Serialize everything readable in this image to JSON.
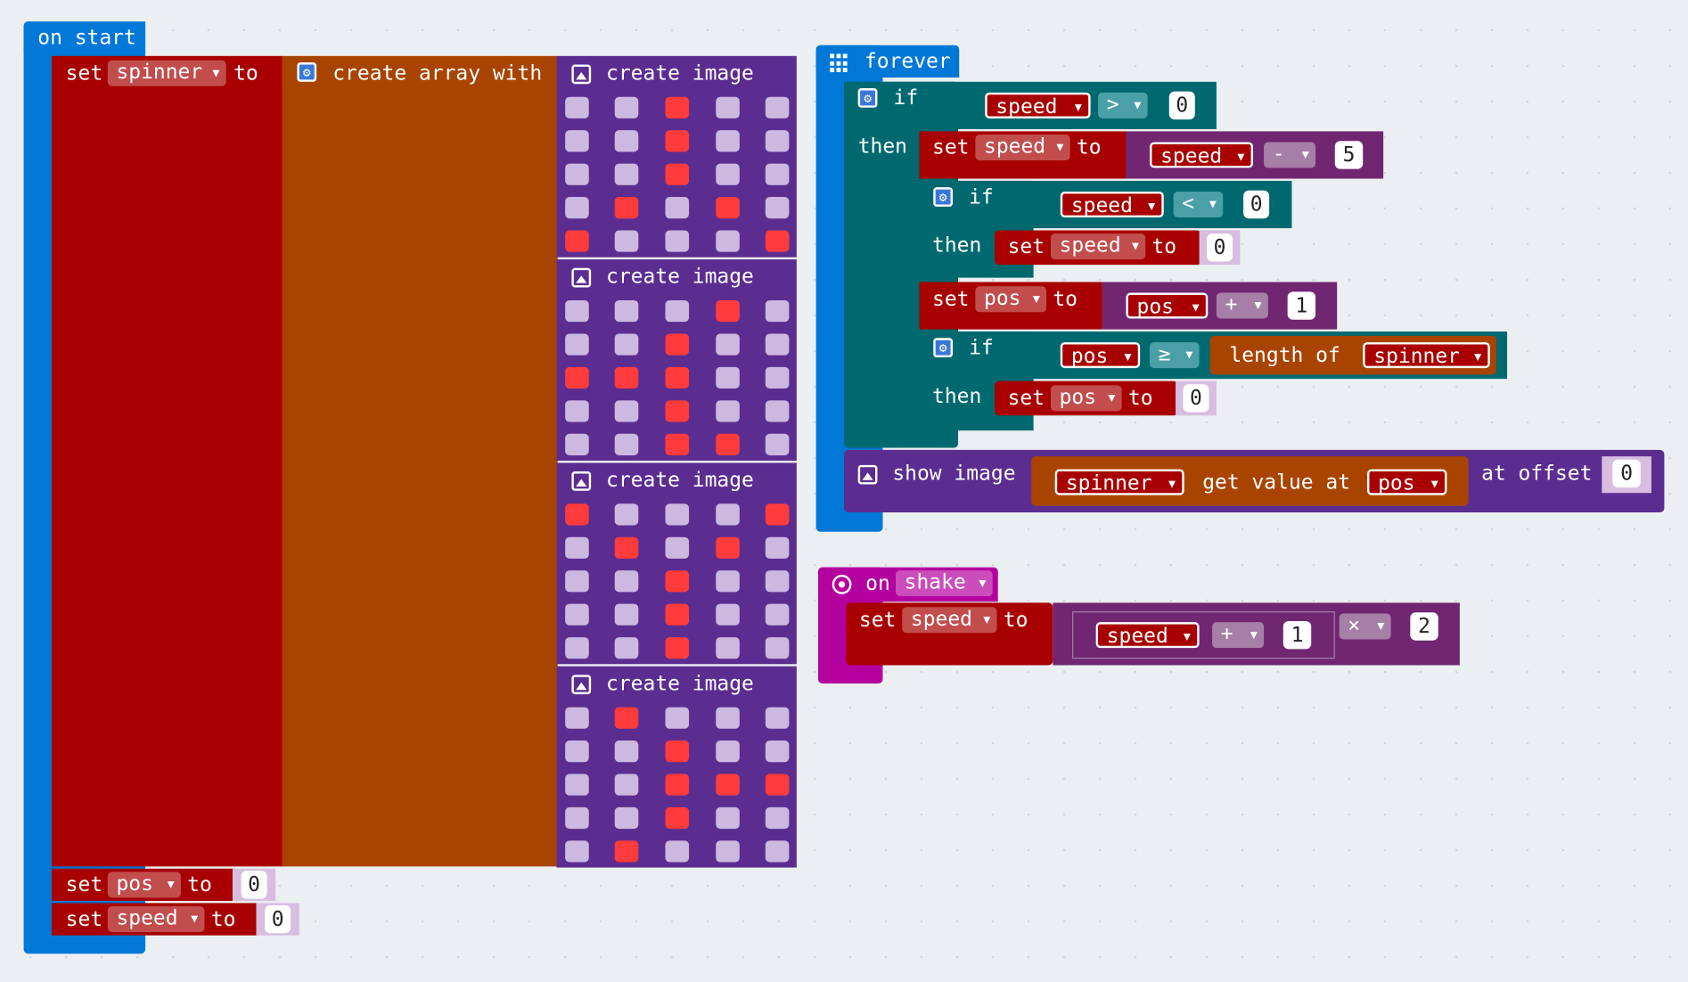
{
  "colors": {
    "event_blue": "#0078d7",
    "variables_red": "#a80000",
    "arrays_orange": "#a94400",
    "images_purple": "#5c2d91",
    "logic_teal": "#006970",
    "math_purple": "#712672",
    "input_magenta": "#b4009e",
    "led_on": "#ff3b3b",
    "led_off": "#cdb8e0"
  },
  "on_start": {
    "label": "on start",
    "set_spinner": {
      "set": "set",
      "var": "spinner",
      "to": "to"
    },
    "create_array_label": "create array with",
    "create_image_label": "create image",
    "images": [
      [
        [
          0,
          0,
          1,
          0,
          0
        ],
        [
          0,
          0,
          1,
          0,
          0
        ],
        [
          0,
          0,
          1,
          0,
          0
        ],
        [
          0,
          1,
          0,
          1,
          0
        ],
        [
          1,
          0,
          0,
          0,
          1
        ]
      ],
      [
        [
          0,
          0,
          0,
          1,
          0
        ],
        [
          0,
          0,
          1,
          0,
          0
        ],
        [
          1,
          1,
          1,
          0,
          0
        ],
        [
          0,
          0,
          1,
          0,
          0
        ],
        [
          0,
          0,
          1,
          1,
          0
        ]
      ],
      [
        [
          1,
          0,
          0,
          0,
          1
        ],
        [
          0,
          1,
          0,
          1,
          0
        ],
        [
          0,
          0,
          1,
          0,
          0
        ],
        [
          0,
          0,
          1,
          0,
          0
        ],
        [
          0,
          0,
          1,
          0,
          0
        ]
      ],
      [
        [
          0,
          1,
          0,
          0,
          0
        ],
        [
          0,
          0,
          1,
          0,
          0
        ],
        [
          0,
          0,
          1,
          1,
          1
        ],
        [
          0,
          0,
          1,
          0,
          0
        ],
        [
          0,
          1,
          0,
          0,
          0
        ]
      ]
    ],
    "set_pos": {
      "set": "set",
      "var": "pos",
      "to": "to",
      "value": "0"
    },
    "set_speed": {
      "set": "set",
      "var": "speed",
      "to": "to",
      "value": "0"
    }
  },
  "forever": {
    "label": "forever",
    "if1": {
      "if": "if",
      "then": "then",
      "var": "speed",
      "op": ">",
      "value": "0"
    },
    "set_speed_sub": {
      "set": "set",
      "var": "speed",
      "to": "to",
      "operand": "speed",
      "op": "-",
      "value": "5"
    },
    "if2": {
      "if": "if",
      "then": "then",
      "var": "speed",
      "op": "<",
      "value": "0"
    },
    "set_speed_zero": {
      "set": "set",
      "var": "speed",
      "to": "to",
      "value": "0"
    },
    "set_pos_inc": {
      "set": "set",
      "var": "pos",
      "to": "to",
      "operand": "pos",
      "op": "+",
      "value": "1"
    },
    "if3": {
      "if": "if",
      "then": "then",
      "var": "pos",
      "op": "≥",
      "length_of": "length of",
      "array": "spinner"
    },
    "set_pos_zero": {
      "set": "set",
      "var": "pos",
      "to": "to",
      "value": "0"
    },
    "show_image": {
      "label": "show image",
      "array": "spinner",
      "get_value_at": "get value at",
      "index": "pos",
      "at_offset": "at offset",
      "offset": "0"
    }
  },
  "on_shake": {
    "on": "on",
    "gesture": "shake",
    "set": "set",
    "var": "speed",
    "to": "to",
    "operand": "speed",
    "op1": "+",
    "value1": "1",
    "op2": "×",
    "value2": "2"
  }
}
